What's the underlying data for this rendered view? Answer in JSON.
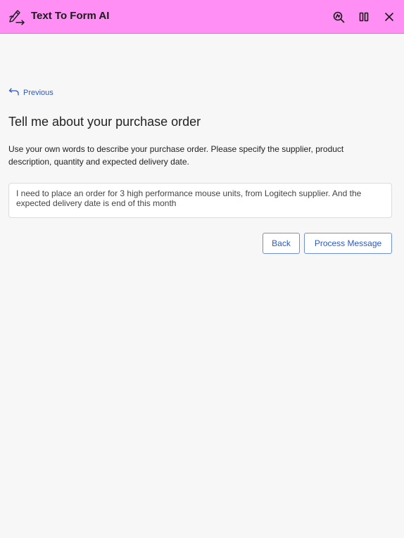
{
  "header": {
    "title": "Text To Form AI",
    "icon": "pencil-convert-icon",
    "actions": [
      {
        "icon": "explore-search-icon"
      },
      {
        "icon": "split-view-icon"
      },
      {
        "icon": "close-icon"
      }
    ],
    "background": "#ff8ef5"
  },
  "nav": {
    "previous_label": "Previous"
  },
  "main": {
    "heading": "Tell me about your purchase order",
    "instructions": "Use your own words to describe your purchase order.  Please specify the supplier, product description, quantity and expected delivery date.",
    "message": "I need to place an order for 3 high performance mouse units, from Logitech supplier. And the expected delivery date is end of this month"
  },
  "actions": {
    "back_label": "Back",
    "process_label": "Process Message"
  },
  "colors": {
    "accent": "#2b59c3",
    "header_bg": "#ff8ef5",
    "page_bg": "#f7f7f7"
  }
}
